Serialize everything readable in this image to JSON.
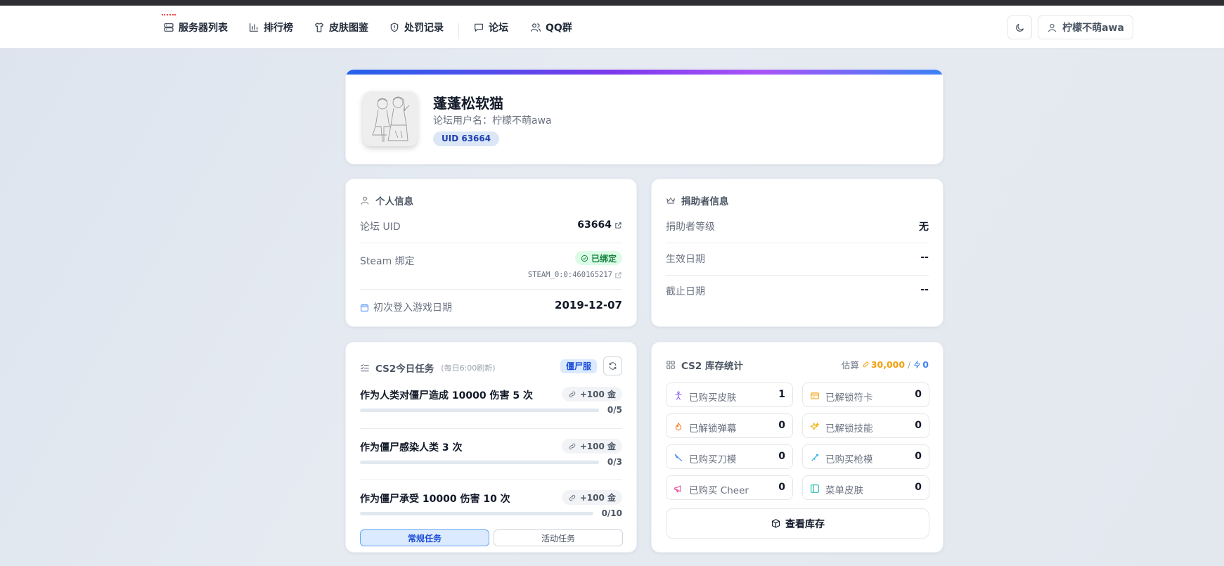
{
  "nav": {
    "items": [
      {
        "label": "服务器列表",
        "icon": "server-icon"
      },
      {
        "label": "排行榜",
        "icon": "bar-chart-icon"
      },
      {
        "label": "皮肤图鉴",
        "icon": "shirt-icon"
      },
      {
        "label": "处罚记录",
        "icon": "shield-icon"
      },
      {
        "label": "论坛",
        "icon": "message-icon"
      },
      {
        "label": "QQ群",
        "icon": "users-icon"
      }
    ],
    "user_label": "柠檬不萌awa"
  },
  "profile": {
    "name": "蓬蓬松软猫",
    "forum_username": "论坛用户名：柠檬不萌awa",
    "uid_badge": "UID 63664"
  },
  "personal": {
    "title": "个人信息",
    "forum_uid_label": "论坛 UID",
    "forum_uid_value": "63664",
    "steam_label": "Steam 绑定",
    "steam_status": "已绑定",
    "steam_id": "STEAM_0:0:460165217",
    "first_login_label": "初次登入游戏日期",
    "first_login_value": "2019-12-07"
  },
  "donor": {
    "title": "捐助者信息",
    "level_label": "捐助者等级",
    "level_value": "无",
    "start_label": "生效日期",
    "start_value": "--",
    "end_label": "截止日期",
    "end_value": "--"
  },
  "tasks": {
    "title": "CS2今日任务",
    "hint": "(每日6:00刷新)",
    "server_tag": "僵尸服",
    "items": [
      {
        "title": "作为人类对僵尸造成 10000 伤害 5 次",
        "reward": "+100 金",
        "progress": "0/5",
        "fraction": 0
      },
      {
        "title": "作为僵尸感染人类 3 次",
        "reward": "+100 金",
        "progress": "0/3",
        "fraction": 0
      },
      {
        "title": "作为僵尸承受 10000 伤害 10 次",
        "reward": "+100 金",
        "progress": "0/10",
        "fraction": 0
      }
    ],
    "tab_regular": "常规任务",
    "tab_event": "活动任务"
  },
  "stock": {
    "title": "CS2 库存统计",
    "estimate_label": "估算",
    "gold_value": "30,000",
    "sep": "/",
    "energy_value": "0",
    "stats": [
      {
        "label": "已购买皮肤",
        "value": "1",
        "icon": "figure-icon",
        "color": "#8b5cf6"
      },
      {
        "label": "已解锁符卡",
        "value": "0",
        "icon": "card-icon",
        "color": "#f59e0b"
      },
      {
        "label": "已解锁弹幕",
        "value": "0",
        "icon": "flame-icon",
        "color": "#f97316"
      },
      {
        "label": "已解锁技能",
        "value": "0",
        "icon": "sparkle-icon",
        "color": "#eab308"
      },
      {
        "label": "已购买刀模",
        "value": "0",
        "icon": "knife-icon",
        "color": "#3b82f6"
      },
      {
        "label": "已购买枪模",
        "value": "0",
        "icon": "gun-icon",
        "color": "#0ea5e9"
      },
      {
        "label": "已购买 Cheer",
        "value": "0",
        "icon": "megaphone-icon",
        "color": "#ec4899"
      },
      {
        "label": "菜单皮肤",
        "value": "0",
        "icon": "panel-icon",
        "color": "#14b8a6"
      }
    ],
    "inventory_button": "查看库存"
  }
}
